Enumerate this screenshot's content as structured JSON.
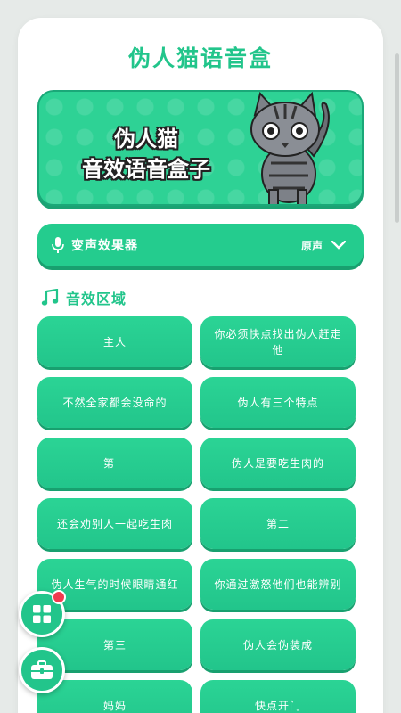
{
  "app": {
    "title": "伪人猫语音盒"
  },
  "banner": {
    "line1": "伪人猫",
    "line2": "音效语音盒子"
  },
  "voice_changer": {
    "label": "变声效果器",
    "value": "原声",
    "icon": "microphone-icon"
  },
  "sounds_section": {
    "title": "音效区域",
    "icon": "music-note-icon"
  },
  "sounds": [
    "主人",
    "你必须快点找出伪人赶走他",
    "不然全家都会没命的",
    "伪人有三个特点",
    "第一",
    "伪人是要吃生肉的",
    "还会劝别人一起吃生肉",
    "第二",
    "伪人生气的时候眼睛通红",
    "你通过激怒他们也能辨别",
    "第三",
    "伪人会伪装成",
    "妈妈",
    "快点开门"
  ],
  "floating": {
    "grid_icon": "grid-icon",
    "toolbox_icon": "toolbox-icon",
    "badge_color": "#f23b4f"
  },
  "colors": {
    "accent": "#22c58b",
    "background": "#e6eae8"
  }
}
